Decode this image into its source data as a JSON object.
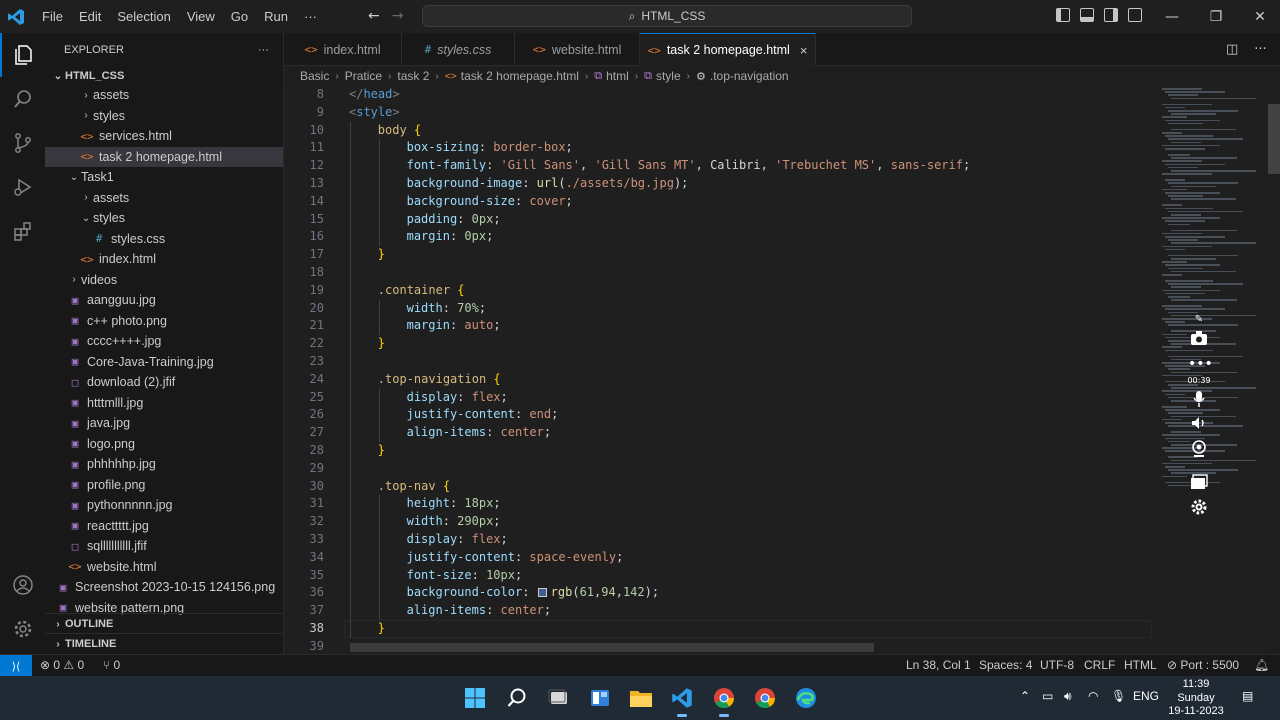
{
  "titlebar": {
    "menu": [
      "File",
      "Edit",
      "Selection",
      "View",
      "Go",
      "Run",
      "···"
    ],
    "search": "HTML_CSS"
  },
  "sidebar": {
    "title": "EXPLORER",
    "more": "···",
    "root": "HTML_CSS",
    "items": [
      {
        "label": "assets",
        "depth": 2,
        "type": "folder-closed"
      },
      {
        "label": "styles",
        "depth": 2,
        "type": "folder-closed"
      },
      {
        "label": "services.html",
        "depth": 2,
        "type": "html"
      },
      {
        "label": "task 2 homepage.html",
        "depth": 2,
        "type": "html",
        "selected": true
      },
      {
        "label": "Task1",
        "depth": 1,
        "type": "folder-open"
      },
      {
        "label": "assets",
        "depth": 2,
        "type": "folder-closed"
      },
      {
        "label": "styles",
        "depth": 2,
        "type": "folder-open"
      },
      {
        "label": "styles.css",
        "depth": 3,
        "type": "css"
      },
      {
        "label": "index.html",
        "depth": 2,
        "type": "html"
      },
      {
        "label": "videos",
        "depth": 1,
        "type": "folder-closed"
      },
      {
        "label": "aangguu.jpg",
        "depth": 1,
        "type": "img"
      },
      {
        "label": "c++ photo.png",
        "depth": 1,
        "type": "img"
      },
      {
        "label": "cccc++++.jpg",
        "depth": 1,
        "type": "img"
      },
      {
        "label": "Core-Java-Training.jpg",
        "depth": 1,
        "type": "img"
      },
      {
        "label": "download (2).jfif",
        "depth": 1,
        "type": "file"
      },
      {
        "label": "htttmlll.jpg",
        "depth": 1,
        "type": "img"
      },
      {
        "label": "java.jpg",
        "depth": 1,
        "type": "img"
      },
      {
        "label": "logo.png",
        "depth": 1,
        "type": "img"
      },
      {
        "label": "phhhhhp.jpg",
        "depth": 1,
        "type": "img"
      },
      {
        "label": "profile.png",
        "depth": 1,
        "type": "img"
      },
      {
        "label": "pythonnnnn.jpg",
        "depth": 1,
        "type": "img"
      },
      {
        "label": "reacttttt.jpg",
        "depth": 1,
        "type": "img"
      },
      {
        "label": "sqlllllllllll.jfif",
        "depth": 1,
        "type": "file"
      },
      {
        "label": "website.html",
        "depth": 1,
        "type": "html"
      },
      {
        "label": "Screenshot 2023-10-15 124156.png",
        "depth": 0,
        "type": "img"
      },
      {
        "label": "website pattern.png",
        "depth": 0,
        "type": "img"
      }
    ],
    "outline": "OUTLINE",
    "timeline": "TIMELINE"
  },
  "tabs": [
    {
      "label": "index.html",
      "icon": "<>",
      "kind": "html"
    },
    {
      "label": "styles.css",
      "icon": "#",
      "kind": "css",
      "italic": true
    },
    {
      "label": "website.html",
      "icon": "<>",
      "kind": "html"
    },
    {
      "label": "task 2 homepage.html",
      "icon": "<>",
      "kind": "html",
      "active": true,
      "close": "×"
    }
  ],
  "breadcrumb": [
    "Basic",
    "Pratice",
    "task 2",
    "task 2 homepage.html",
    "html",
    "style",
    ".top-navigation"
  ],
  "editor": {
    "current_line": 38,
    "lines": [
      {
        "n": "8",
        "indent": 0,
        "tokens": [
          [
            "punc",
            "</"
          ],
          [
            "tag",
            "head"
          ],
          [
            "punc",
            ">"
          ]
        ]
      },
      {
        "n": "9",
        "indent": 0,
        "tokens": [
          [
            "punc",
            "<"
          ],
          [
            "tag",
            "style"
          ],
          [
            "punc",
            ">"
          ]
        ]
      },
      {
        "n": "10",
        "indent": 1,
        "tokens": [
          [
            "sel",
            "body "
          ],
          [
            "brace",
            "{"
          ]
        ]
      },
      {
        "n": "11",
        "indent": 2,
        "tokens": [
          [
            "prop",
            "box-sizing"
          ],
          [
            "plain",
            ": "
          ],
          [
            "val",
            "border-box"
          ],
          [
            "plain",
            ";"
          ]
        ]
      },
      {
        "n": "12",
        "indent": 2,
        "tokens": [
          [
            "prop",
            "font-family"
          ],
          [
            "plain",
            ": "
          ],
          [
            "val",
            "'Gill Sans'"
          ],
          [
            "plain",
            ", "
          ],
          [
            "val",
            "'Gill Sans MT'"
          ],
          [
            "plain",
            ", Calibri, "
          ],
          [
            "val",
            "'Trebuchet MS'"
          ],
          [
            "plain",
            ", "
          ],
          [
            "val",
            "sans-serif"
          ],
          [
            "plain",
            ";"
          ]
        ]
      },
      {
        "n": "13",
        "indent": 2,
        "tokens": [
          [
            "prop",
            "background-image"
          ],
          [
            "plain",
            ": "
          ],
          [
            "fn",
            "url"
          ],
          [
            "plain",
            "("
          ],
          [
            "val",
            "./assets/bg.jpg"
          ],
          [
            "plain",
            ");"
          ]
        ]
      },
      {
        "n": "14",
        "indent": 2,
        "tokens": [
          [
            "prop",
            "background-size"
          ],
          [
            "plain",
            ": "
          ],
          [
            "val",
            "cover"
          ],
          [
            "plain",
            ";"
          ]
        ]
      },
      {
        "n": "15",
        "indent": 2,
        "tokens": [
          [
            "prop",
            "padding"
          ],
          [
            "plain",
            ": "
          ],
          [
            "num",
            "0px"
          ],
          [
            "plain",
            ";"
          ]
        ]
      },
      {
        "n": "16",
        "indent": 2,
        "tokens": [
          [
            "prop",
            "margin"
          ],
          [
            "plain",
            ": "
          ],
          [
            "num",
            "0px"
          ],
          [
            "plain",
            ";"
          ]
        ]
      },
      {
        "n": "17",
        "indent": 1,
        "tokens": [
          [
            "brace",
            "}"
          ]
        ]
      },
      {
        "n": "18",
        "indent": 0,
        "tokens": []
      },
      {
        "n": "19",
        "indent": 1,
        "tokens": [
          [
            "sel",
            ".container "
          ],
          [
            "brace",
            "{"
          ]
        ]
      },
      {
        "n": "20",
        "indent": 2,
        "tokens": [
          [
            "prop",
            "width"
          ],
          [
            "plain",
            ": "
          ],
          [
            "num",
            "70%"
          ],
          [
            "plain",
            ";"
          ]
        ]
      },
      {
        "n": "21",
        "indent": 2,
        "tokens": [
          [
            "prop",
            "margin"
          ],
          [
            "plain",
            ": "
          ],
          [
            "val",
            "auto"
          ],
          [
            "plain",
            ";"
          ]
        ]
      },
      {
        "n": "22",
        "indent": 1,
        "tokens": [
          [
            "brace",
            "}"
          ]
        ]
      },
      {
        "n": "23",
        "indent": 0,
        "tokens": []
      },
      {
        "n": "24",
        "indent": 1,
        "tokens": [
          [
            "sel",
            ".top-navigation "
          ],
          [
            "brace",
            "{"
          ]
        ]
      },
      {
        "n": "25",
        "indent": 2,
        "tokens": [
          [
            "prop",
            "display"
          ],
          [
            "plain",
            ": "
          ],
          [
            "val",
            "flex"
          ],
          [
            "plain",
            ";"
          ]
        ]
      },
      {
        "n": "26",
        "indent": 2,
        "tokens": [
          [
            "prop",
            "justify-content"
          ],
          [
            "plain",
            ": "
          ],
          [
            "val",
            "end"
          ],
          [
            "plain",
            ";"
          ]
        ]
      },
      {
        "n": "27",
        "indent": 2,
        "tokens": [
          [
            "prop",
            "align-items"
          ],
          [
            "plain",
            ": "
          ],
          [
            "val",
            "center"
          ],
          [
            "plain",
            ";"
          ]
        ]
      },
      {
        "n": "28",
        "indent": 1,
        "tokens": [
          [
            "brace",
            "}"
          ]
        ]
      },
      {
        "n": "29",
        "indent": 0,
        "tokens": []
      },
      {
        "n": "30",
        "indent": 1,
        "tokens": [
          [
            "sel",
            ".top-nav "
          ],
          [
            "brace",
            "{"
          ]
        ]
      },
      {
        "n": "31",
        "indent": 2,
        "tokens": [
          [
            "prop",
            "height"
          ],
          [
            "plain",
            ": "
          ],
          [
            "num",
            "18px"
          ],
          [
            "plain",
            ";"
          ]
        ]
      },
      {
        "n": "32",
        "indent": 2,
        "tokens": [
          [
            "prop",
            "width"
          ],
          [
            "plain",
            ": "
          ],
          [
            "num",
            "290px"
          ],
          [
            "plain",
            ";"
          ]
        ]
      },
      {
        "n": "33",
        "indent": 2,
        "tokens": [
          [
            "prop",
            "display"
          ],
          [
            "plain",
            ": "
          ],
          [
            "val",
            "flex"
          ],
          [
            "plain",
            ";"
          ]
        ]
      },
      {
        "n": "34",
        "indent": 2,
        "tokens": [
          [
            "prop",
            "justify-content"
          ],
          [
            "plain",
            ": "
          ],
          [
            "val",
            "space-evenly"
          ],
          [
            "plain",
            ";"
          ]
        ]
      },
      {
        "n": "35",
        "indent": 2,
        "tokens": [
          [
            "prop",
            "font-size"
          ],
          [
            "plain",
            ": "
          ],
          [
            "num",
            "10px"
          ],
          [
            "plain",
            ";"
          ]
        ]
      },
      {
        "n": "36",
        "indent": 2,
        "tokens": [
          [
            "prop",
            "background-color"
          ],
          [
            "plain",
            ": "
          ],
          [
            "swatch",
            "#3d5e8e"
          ],
          [
            "fn",
            "rgb"
          ],
          [
            "plain",
            "("
          ],
          [
            "num",
            "61"
          ],
          [
            "plain",
            ","
          ],
          [
            "num",
            "94"
          ],
          [
            "plain",
            ","
          ],
          [
            "num",
            "142"
          ],
          [
            "plain",
            ");"
          ]
        ]
      },
      {
        "n": "37",
        "indent": 2,
        "tokens": [
          [
            "prop",
            "align-items"
          ],
          [
            "plain",
            ": "
          ],
          [
            "val",
            "center"
          ],
          [
            "plain",
            ";"
          ]
        ]
      },
      {
        "n": "38",
        "indent": 1,
        "tokens": [
          [
            "brace",
            "}"
          ]
        ]
      },
      {
        "n": "39",
        "indent": 0,
        "tokens": []
      }
    ]
  },
  "recorder": {
    "time": "00:39"
  },
  "statusbar": {
    "problems": "⊗ 0 ⚠ 0",
    "ports": "⑂ 0",
    "position": "Ln 38, Col 1",
    "spaces": "Spaces: 4",
    "encoding": "UTF-8",
    "eol": "CRLF",
    "language": "HTML",
    "port": "⊘ Port : 5500"
  },
  "taskbar": {
    "lang": "ENG",
    "time": "11:39",
    "day": "Sunday",
    "date": "19-11-2023"
  },
  "colors": {
    "accent": "#0078d4",
    "editor_bg": "#1f1f1f",
    "taskbar_bg": "#202a35"
  }
}
